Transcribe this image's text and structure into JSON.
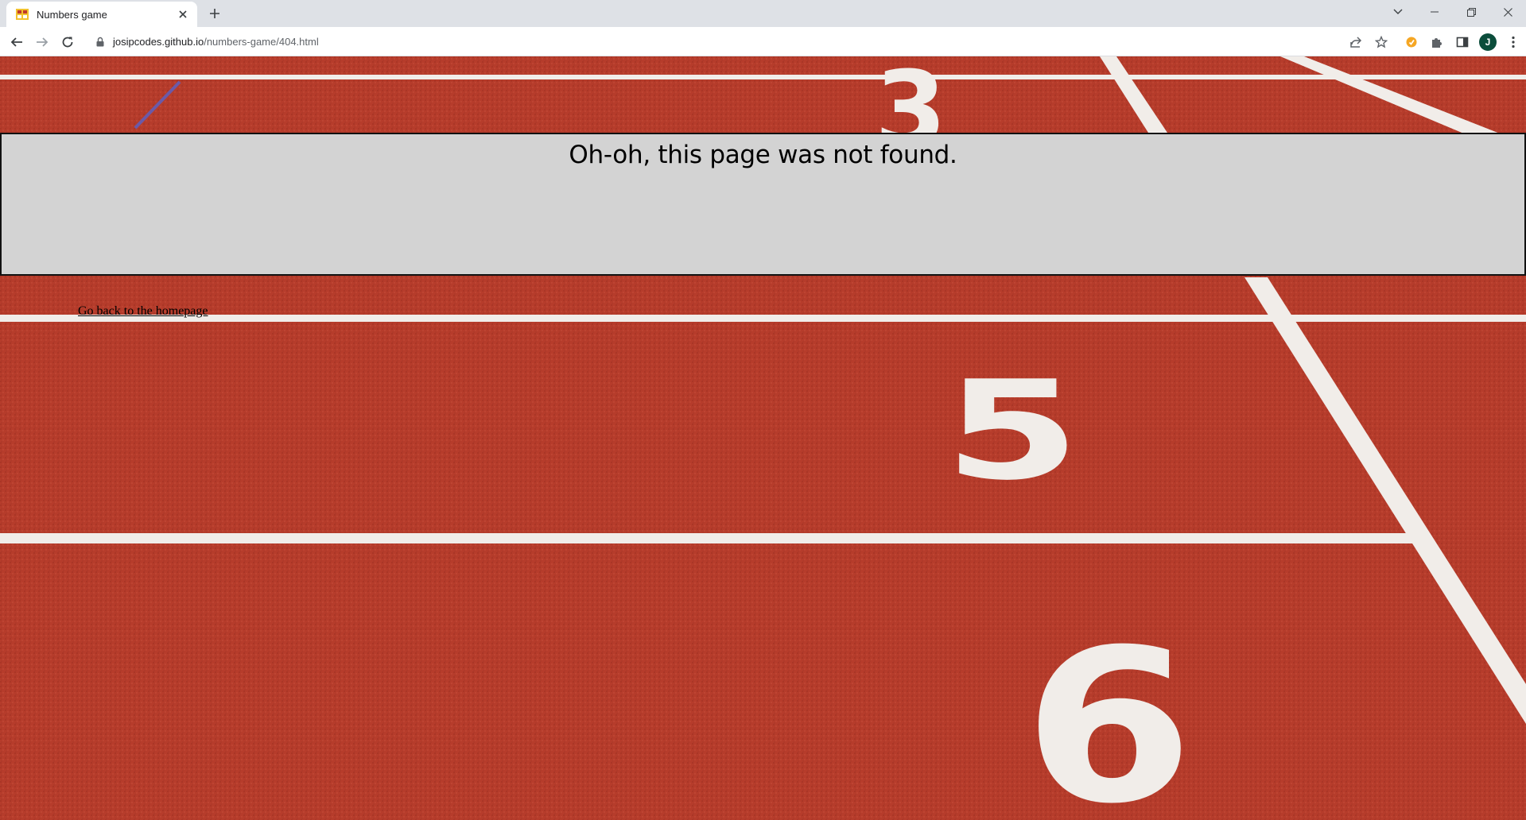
{
  "browser": {
    "tab": {
      "title": "Numbers game",
      "favicon": "numbers-grid-favicon"
    },
    "address_bar": {
      "host": "josipcodes.github.io",
      "path": "/numbers-game/404.html"
    },
    "profile_initial": "J",
    "icons": {
      "back": "back-arrow-icon",
      "forward": "forward-arrow-icon",
      "reload": "reload-icon",
      "lock": "lock-icon",
      "share": "share-icon",
      "bookmark": "star-icon",
      "extension": "puzzle-icon",
      "side_panel": "side-panel-icon",
      "menu": "kebab-menu-icon"
    },
    "colors": {
      "tabstrip": "#dee1e6",
      "avatar": "#0b4d3b"
    }
  },
  "page": {
    "heading": "Oh-oh, this page was not found.",
    "home_link": "Go back to the homepage",
    "background": "running-track-lanes-image",
    "colors": {
      "panel": "#d3d3d3",
      "track": "#b63c2b",
      "lane_line": "#f4f1ee"
    }
  }
}
